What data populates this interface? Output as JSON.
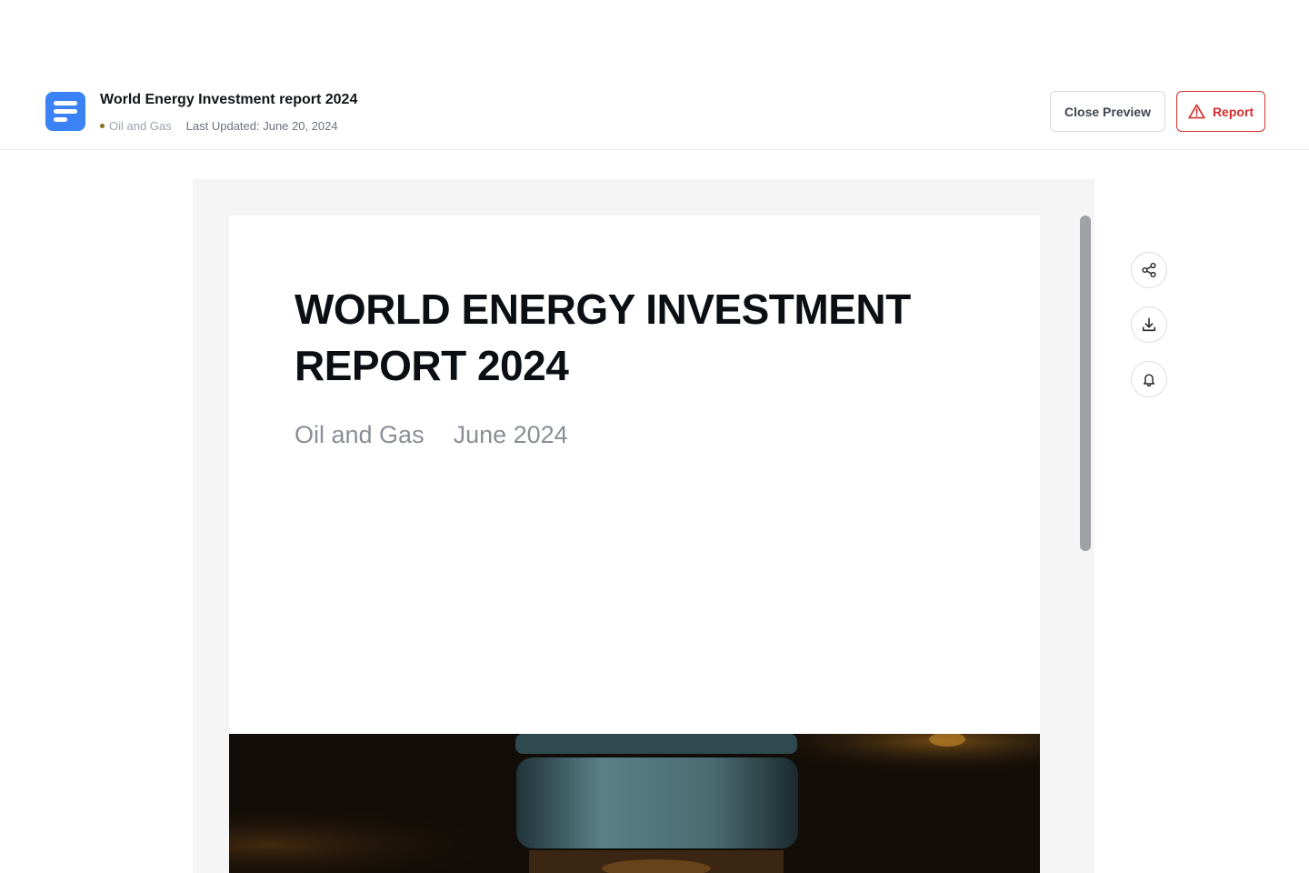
{
  "header": {
    "title": "World Energy Investment report 2024",
    "category": "Oil and Gas",
    "last_updated": "Last Updated: June 20, 2024",
    "close_preview_label": "Close Preview",
    "report_label": "Report",
    "doc_icon": "document-lines-icon",
    "report_icon": "warning-triangle-icon"
  },
  "document": {
    "cover_title": "WORLD ENERGY INVESTMENT REPORT 2024",
    "cover_category": "Oil and Gas",
    "cover_date": "June 2024"
  },
  "tools": [
    {
      "name": "share",
      "icon": "share-icon"
    },
    {
      "name": "download",
      "icon": "download-icon"
    },
    {
      "name": "notify",
      "icon": "bell-icon"
    }
  ],
  "colors": {
    "brand": "#3b82f6",
    "report": "#d32f2f",
    "viewer_bg": "#f5f5f5"
  }
}
